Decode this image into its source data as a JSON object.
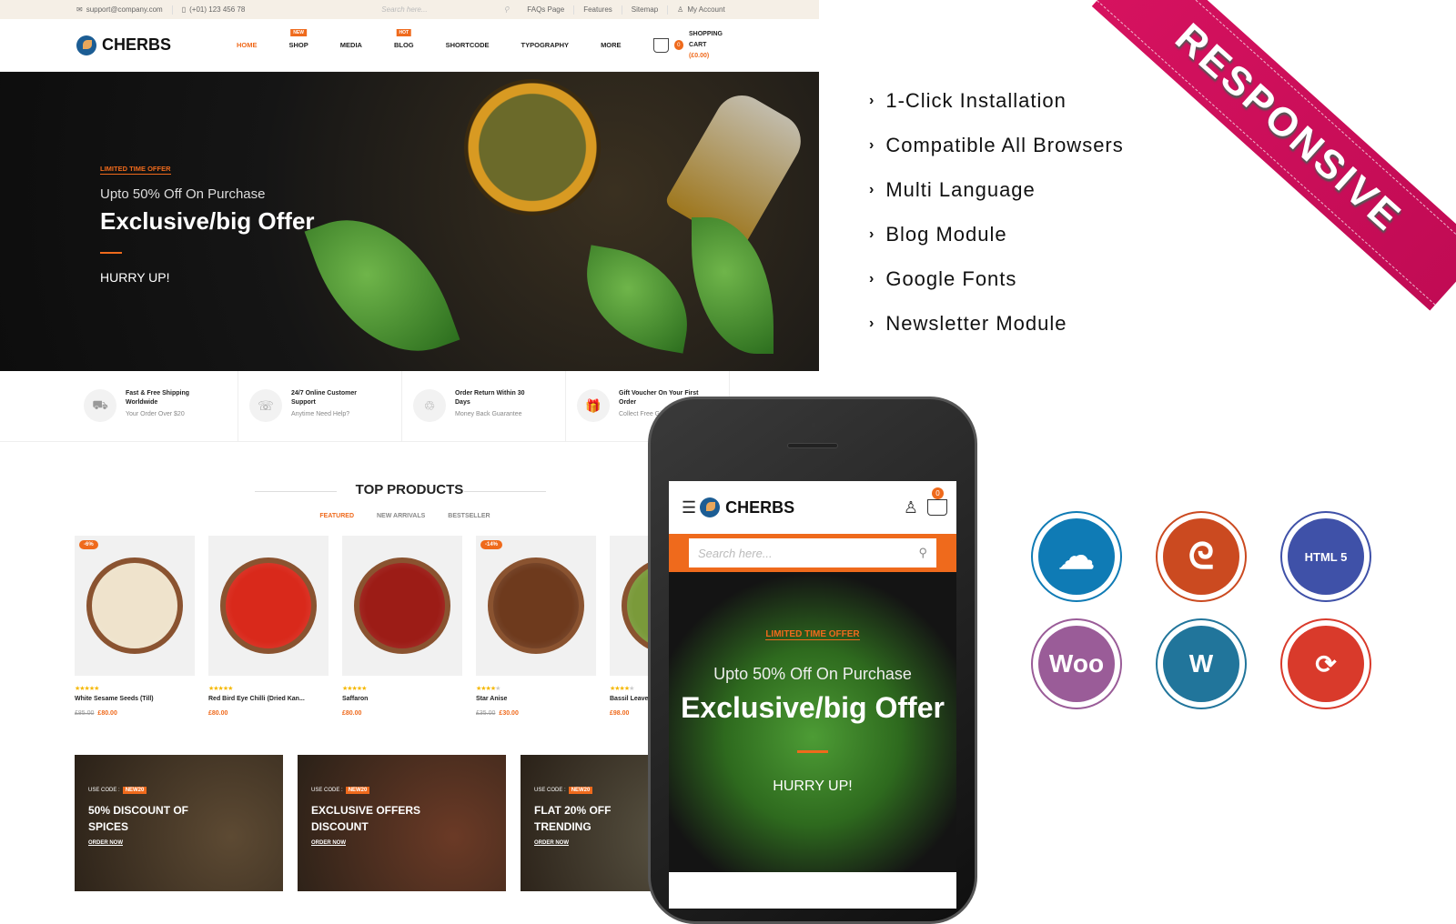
{
  "desktop": {
    "topbar": {
      "email": "support@company.com",
      "phone": "(+01) 123 456 78",
      "search_placeholder": "Search here...",
      "links": [
        "FAQs Page",
        "Features",
        "Sitemap",
        "My Account"
      ]
    },
    "header": {
      "brand": "CHERBS",
      "nav": [
        {
          "label": "HOME",
          "tag": null
        },
        {
          "label": "SHOP",
          "tag": "NEW"
        },
        {
          "label": "MEDIA",
          "tag": null
        },
        {
          "label": "BLOG",
          "tag": "HOT"
        },
        {
          "label": "SHORTCODE",
          "tag": null
        },
        {
          "label": "TYPOGRAPHY",
          "tag": null
        },
        {
          "label": "MORE",
          "tag": null
        }
      ],
      "cart_count": "0",
      "cart_label": "SHOPPING CART",
      "cart_total": "(£0.00)"
    },
    "hero": {
      "kicker": "LIMITED TIME OFFER",
      "subtitle": "Upto 50% Off On Purchase",
      "title": "Exclusive/big Offer",
      "cta": "HURRY UP!"
    },
    "features": [
      {
        "icon": "shipping-icon",
        "title": "Fast & Free Shipping Worldwide",
        "sub": "Your Order Over $20"
      },
      {
        "icon": "support-icon",
        "title": "24/7 Online Customer Support",
        "sub": "Anytime Need Help?"
      },
      {
        "icon": "piggy-bank-icon",
        "title": "Order Return Within 30 Days",
        "sub": "Money Back Guarantee"
      },
      {
        "icon": "gift-icon",
        "title": "Gift Voucher On Your First Order",
        "sub": "Collect Free Gift"
      }
    ],
    "top_products": {
      "title": "TOP PRODUCTS",
      "tabs": [
        "FEATURED",
        "NEW ARRIVALS",
        "BESTSELLER"
      ],
      "active_tab": "FEATURED",
      "items": [
        {
          "name": "White Sesame Seeds (Till)",
          "discount": "-6%",
          "old_price": "£85.00",
          "price": "£80.00",
          "rating": 5,
          "color": "#efe3cc"
        },
        {
          "name": "Red Bird Eye Chilli (Dried Kan...",
          "discount": null,
          "old_price": null,
          "price": "£80.00",
          "rating": 5,
          "color": "#d9291b"
        },
        {
          "name": "Saffaron",
          "discount": null,
          "old_price": null,
          "price": "£80.00",
          "rating": 5,
          "color": "#9c1c16"
        },
        {
          "name": "Star Anise",
          "discount": "-14%",
          "old_price": "£35.00",
          "price": "£30.00",
          "rating": 4,
          "color": "#6e3a1d"
        },
        {
          "name": "Bassil Leaves",
          "discount": null,
          "old_price": null,
          "price": "£98.00",
          "rating": 4,
          "color": "#7a9a3a"
        }
      ]
    },
    "banners": [
      {
        "code_label": "USE CODE :",
        "code": "NEW20",
        "title": "50% DISCOUNT OF SPICES",
        "link": "ORDER NOW",
        "bg": "#5d4a33"
      },
      {
        "code_label": "USE CODE :",
        "code": "NEW20",
        "title": "EXCLUSIVE OFFERS DISCOUNT",
        "link": "ORDER NOW",
        "bg": "#6b3a26"
      },
      {
        "code_label": "USE CODE :",
        "code": "NEW20",
        "title": "FLAT 20% OFF TRENDING",
        "link": "ORDER NOW",
        "bg": "#5a5443"
      }
    ]
  },
  "feature_list": [
    "1-Click Installation",
    "Compatible All Browsers",
    "Multi Language",
    "Blog Module",
    "Google Fonts",
    "Newsletter Module"
  ],
  "ribbon": "RESPONSIVE",
  "tech_icons": [
    {
      "name": "chef-hat-icon",
      "label": "",
      "color": "#0f7bb5"
    },
    {
      "name": "opencart-swirl-icon",
      "label": "",
      "color": "#cb4a20"
    },
    {
      "name": "html5-icon",
      "label": "HTML 5",
      "color": "#3f51a8"
    },
    {
      "name": "woocommerce-icon",
      "label": "Woo",
      "color": "#9a5c98"
    },
    {
      "name": "wordpress-icon",
      "label": "W",
      "color": "#21759b"
    },
    {
      "name": "refresh-icon",
      "label": "⟳",
      "color": "#d93a2b"
    }
  ],
  "mobile": {
    "brand": "CHERBS",
    "cart_count": "0",
    "search_placeholder": "Search here...",
    "hero": {
      "kicker": "LIMITED TIME OFFER",
      "subtitle": "Upto 50% Off On Purchase",
      "title": "Exclusive/big Offer",
      "cta": "HURRY UP!"
    }
  }
}
